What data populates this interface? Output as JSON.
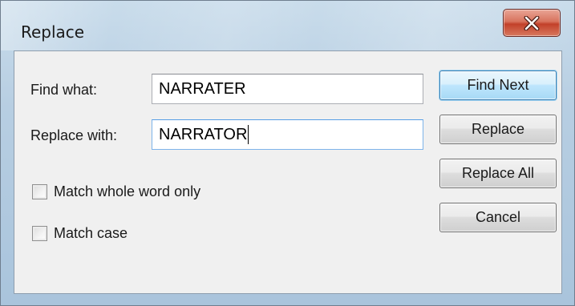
{
  "window": {
    "title": "Replace"
  },
  "fields": {
    "find_label": "Find what:",
    "find_value": "NARRATER",
    "replace_label": "Replace with:",
    "replace_value": "NARRATOR"
  },
  "options": {
    "whole_word": {
      "label": "Match whole word only",
      "checked": false
    },
    "match_case": {
      "label": "Match case",
      "checked": false
    }
  },
  "buttons": {
    "find_next": "Find Next",
    "replace": "Replace",
    "replace_all": "Replace All",
    "cancel": "Cancel"
  },
  "icons": {
    "close": "close-icon"
  },
  "colors": {
    "close_button": "#c2412a",
    "default_button_border": "#3c7fb1"
  }
}
